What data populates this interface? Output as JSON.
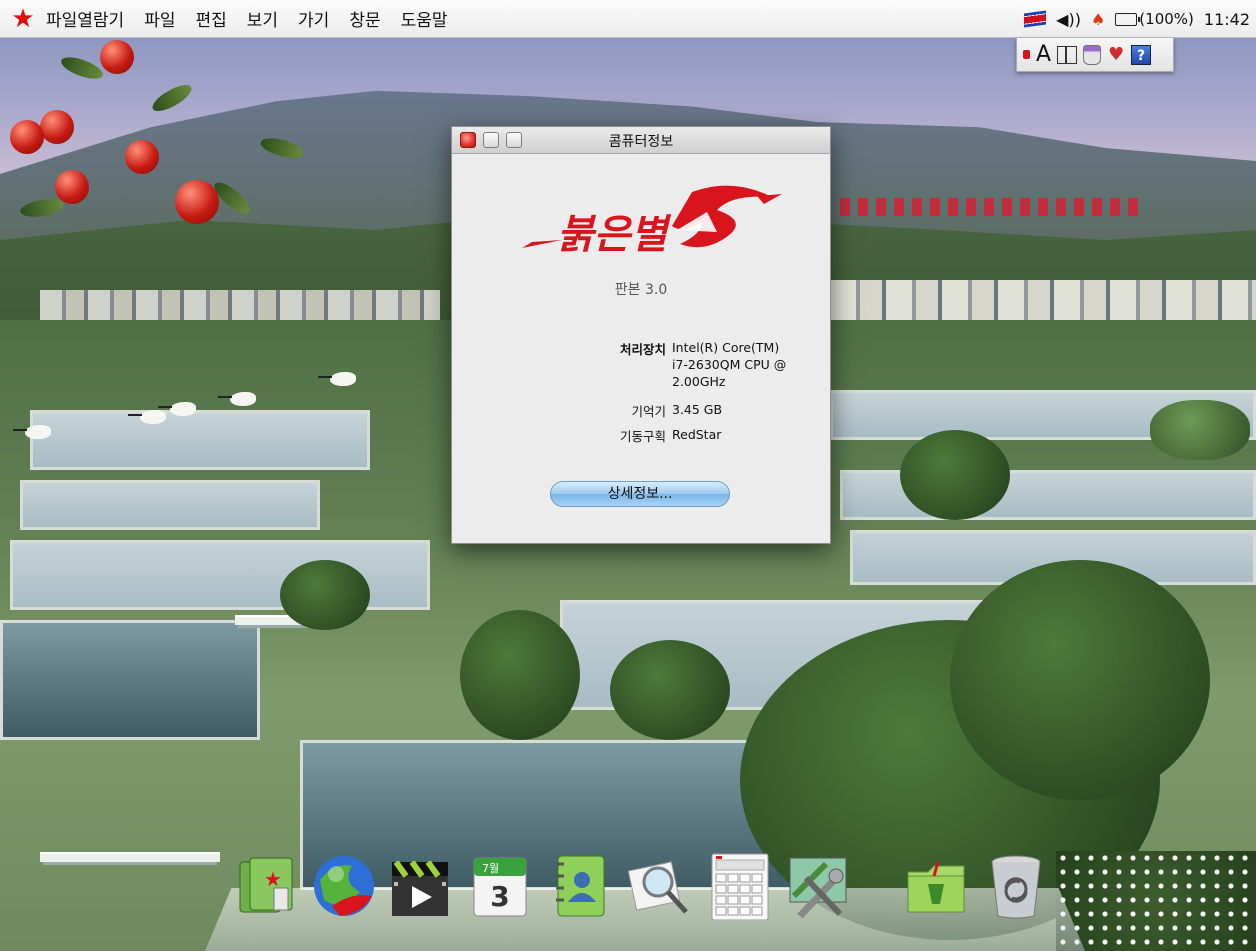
{
  "menubar": {
    "logo_icon": "red-star-icon",
    "items": [
      "파일열람기",
      "파일",
      "편집",
      "보기",
      "가기",
      "창문",
      "도움말"
    ],
    "status": {
      "flag_icon": "flag-icon",
      "volume_icon": "speaker-icon",
      "fire_icon": "torch-icon",
      "battery_icon": "battery-icon",
      "battery_text": "(100%)",
      "clock": "11:42"
    }
  },
  "ime_palette": {
    "indicator": "red-indicator",
    "letter": "A",
    "icons": [
      "layout-toggle-icon",
      "brush-icon",
      "tools-icon",
      "help-icon"
    ],
    "help_label": "?"
  },
  "about_window": {
    "title": "콤퓨터정보",
    "logo_text": "붉은별",
    "version": "판본 3.0",
    "rows": [
      {
        "label": "처리장치",
        "value_lines": [
          "Intel(R) Core(TM)",
          "i7-2630QM CPU @",
          "2.00GHz"
        ]
      },
      {
        "label": "기억기",
        "value_lines": [
          "3.45 GB"
        ]
      },
      {
        "label": "기동구획",
        "value_lines": [
          "RedStar"
        ]
      }
    ],
    "more_button": "상세정보...",
    "accent": "#e03128"
  },
  "dock": {
    "items": [
      {
        "name": "file-browser-icon"
      },
      {
        "name": "web-browser-globe-icon"
      },
      {
        "name": "video-player-clapper-icon"
      },
      {
        "name": "calendar-icon",
        "month_label": "7월",
        "day_label": "3"
      },
      {
        "name": "address-book-icon"
      },
      {
        "name": "image-viewer-magnifier-icon"
      },
      {
        "name": "calculator-icon"
      },
      {
        "name": "system-preferences-tools-icon"
      },
      {
        "name": "applications-folder-icon"
      },
      {
        "name": "trash-icon"
      }
    ]
  }
}
